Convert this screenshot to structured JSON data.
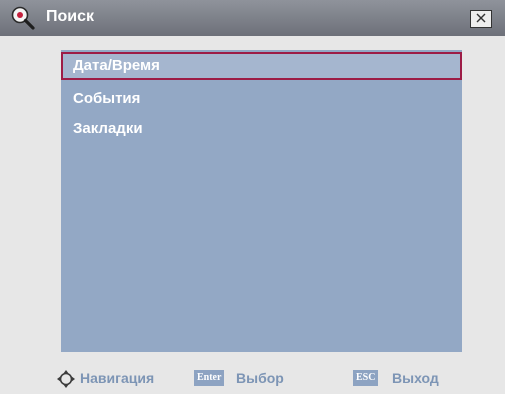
{
  "window": {
    "title": "Поиск",
    "icons": {
      "title": "magnifier-icon",
      "close": "close-x-icon"
    }
  },
  "menu": {
    "items": [
      {
        "label": "Дата/Время",
        "selected": true
      },
      {
        "label": "События",
        "selected": false
      },
      {
        "label": "Закладки",
        "selected": false
      }
    ]
  },
  "footer": {
    "navigation_icon": "four-way-arrows-icon",
    "navigation_label": "Навигация",
    "enter_key": "Enter",
    "enter_label": "Выбор",
    "esc_key": "ESC",
    "esc_label": "Выход"
  },
  "colors": {
    "titlebar": "#7e828a",
    "panel": "#93a8c5",
    "selection_border": "#9d1c46",
    "footer_text": "#7d95b5"
  }
}
